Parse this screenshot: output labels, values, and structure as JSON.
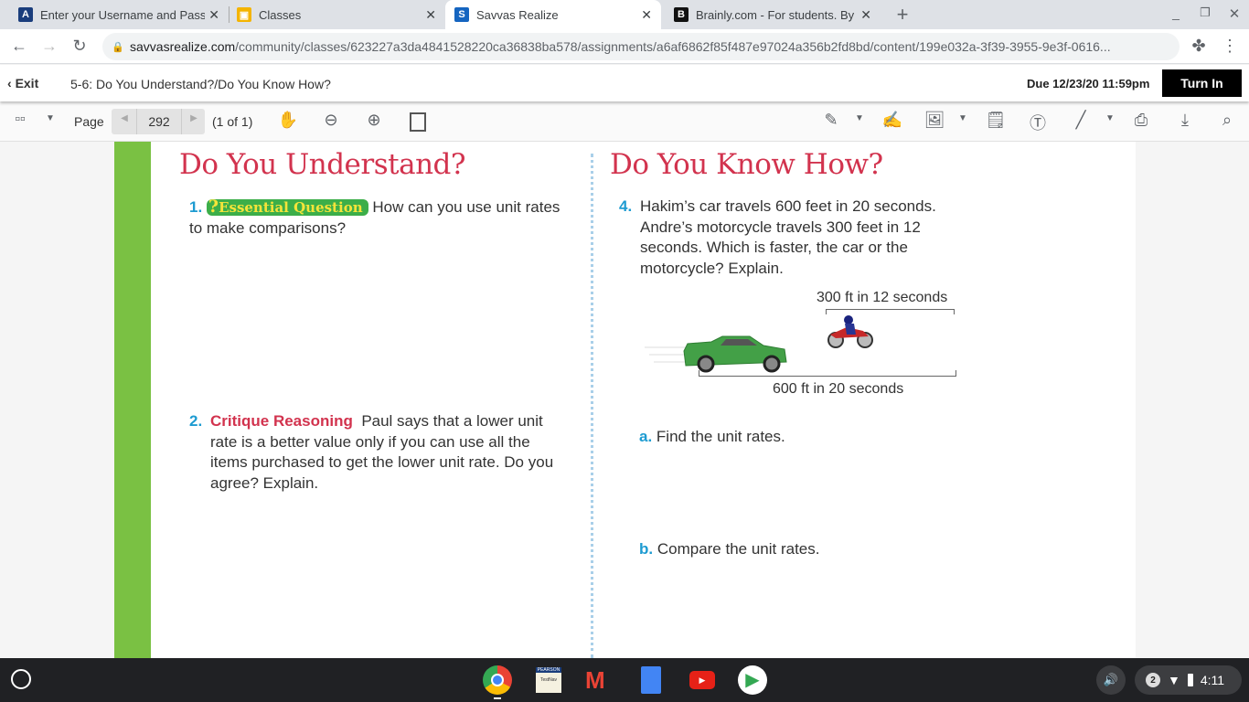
{
  "tabs": [
    {
      "title": "Enter your Username and Password",
      "color": "#1a3d7c",
      "glyph": "A"
    },
    {
      "title": "Classes",
      "color": "#f4b400",
      "glyph": "▣"
    },
    {
      "title": "Savvas Realize",
      "color": "#1565c0",
      "glyph": "S"
    },
    {
      "title": "Brainly.com - For students. By students.",
      "color": "#111",
      "glyph": "B"
    }
  ],
  "address": {
    "host": "savvasrealize.com",
    "path": "/community/classes/623227a3da4841528220ca36838ba578/assignments/a6af6862f85f487e97024a356b2fd8bd/content/199e032a-3f39-3955-9e3f-0616..."
  },
  "header": {
    "exit": "Exit",
    "title": "5-6: Do You Understand?/Do You Know How?",
    "due": "Due 12/23/20 11:59pm",
    "turn_in": "Turn In"
  },
  "toolbar": {
    "page_label": "Page",
    "page_number": "292",
    "page_count": "(1 of 1)"
  },
  "content": {
    "left_heading": "Do You Understand?",
    "right_heading": "Do You Know How?",
    "q1_num": "1.",
    "q1_badge": "Essential Question",
    "q1_text": "How can you use unit rates to make comparisons?",
    "q2_num": "2.",
    "q2_label": "Critique Reasoning",
    "q2_text": "Paul says that a lower unit rate is a better value only if you can use all the items purchased to get the lower unit rate. Do you agree? Explain.",
    "q4_num": "4.",
    "q4_text": "Hakim’s car travels 600 feet in 20 seconds. Andre’s motorcycle travels 300 feet in 12 seconds. Which is faster, the car or the motorcycle? Explain.",
    "moto_label": "300 ft in 12 seconds",
    "car_label": "600 ft in 20 seconds",
    "a_letter": "a.",
    "a_text": "Find the unit rates.",
    "b_letter": "b.",
    "b_text": "Compare the unit rates."
  },
  "taskbar": {
    "notif_count": "2",
    "time": "4:11",
    "testnav_top": "PEARSON",
    "testnav_bottom": "TestNav"
  }
}
